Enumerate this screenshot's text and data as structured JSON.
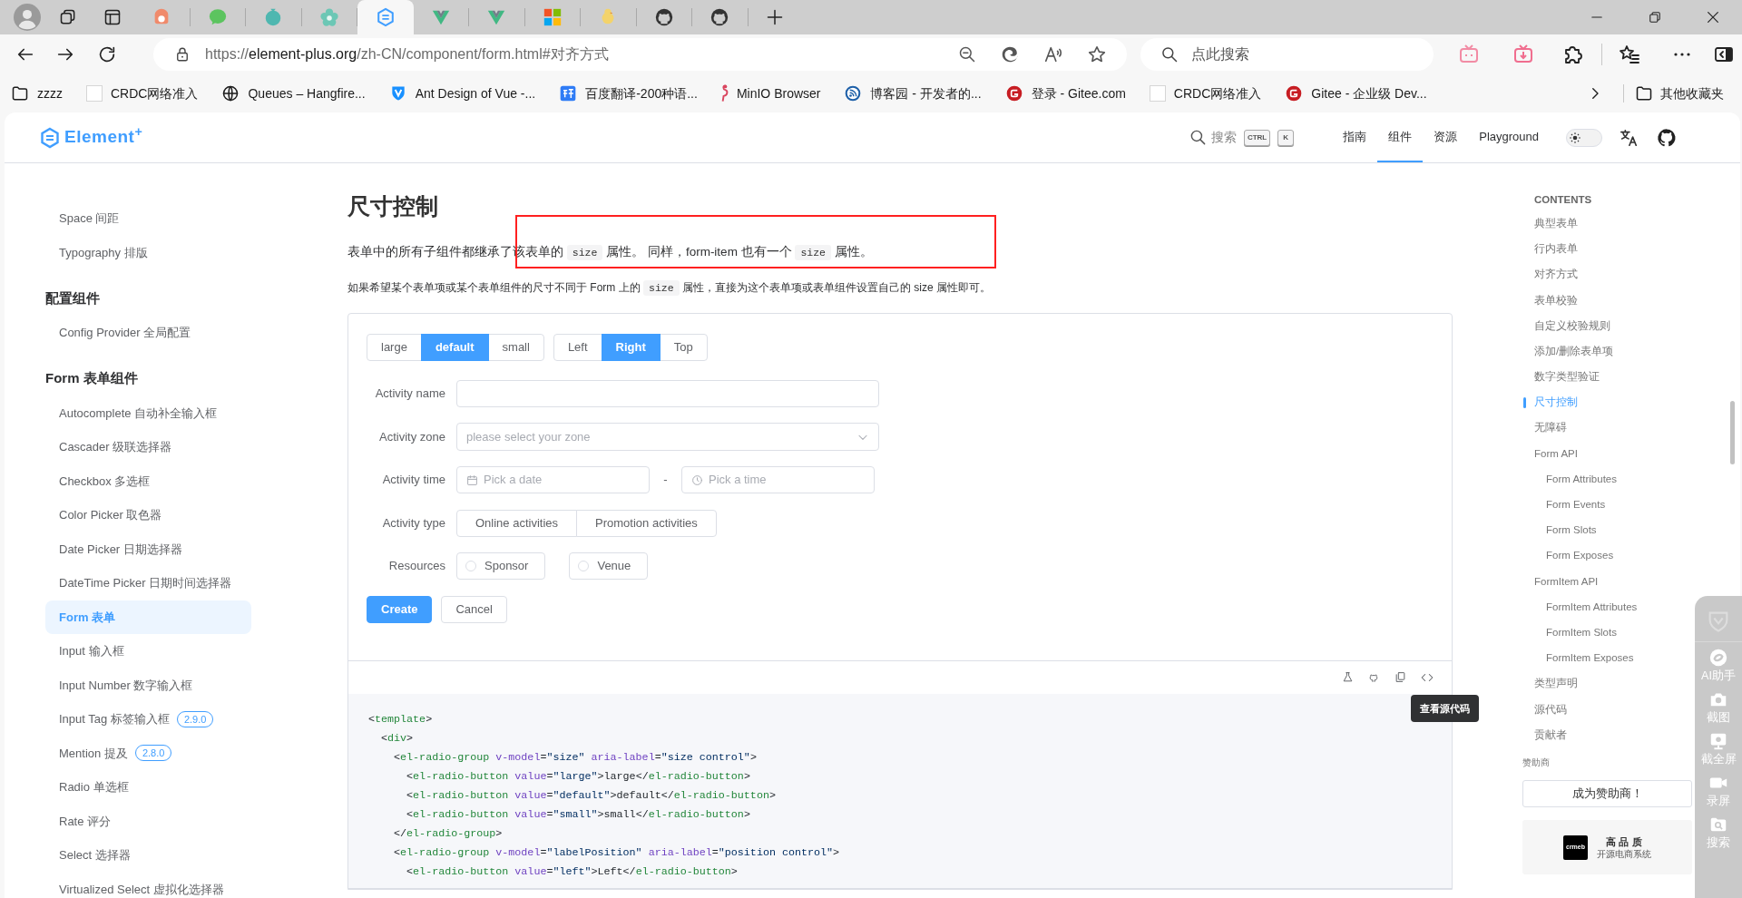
{
  "browser": {
    "tabs": [
      {
        "kind": "bowl",
        "selected": false
      },
      {
        "kind": "chat",
        "selected": false
      },
      {
        "kind": "blob",
        "selected": false
      },
      {
        "kind": "flower",
        "selected": false
      },
      {
        "kind": "hexagon",
        "selected": true
      },
      {
        "kind": "vee",
        "selected": false
      },
      {
        "kind": "vee",
        "selected": false
      },
      {
        "kind": "windows",
        "selected": false
      },
      {
        "kind": "chick",
        "selected": false
      },
      {
        "kind": "cat",
        "selected": false
      },
      {
        "kind": "cat",
        "selected": false
      }
    ],
    "address": {
      "scheme": "https://",
      "host": "element-plus.org",
      "path": "/zh-CN/component/form.html#对齐方式"
    },
    "search": {
      "placeholder": "点此搜索"
    },
    "bookmarks": [
      {
        "kind": "folder",
        "label": "zzzz"
      },
      {
        "kind": "blank",
        "label": "CRDC网络准入"
      },
      {
        "kind": "globe",
        "label": "Queues – Hangfire..."
      },
      {
        "kind": "shield",
        "label": "Ant Design of Vue -..."
      },
      {
        "kind": "translate",
        "label": "百度翻译-200种语..."
      },
      {
        "kind": "flamingo",
        "label": "MinIO Browser"
      },
      {
        "kind": "feed",
        "label": "博客园 - 开发者的..."
      },
      {
        "kind": "red",
        "label": "登录 - Gitee.com"
      },
      {
        "kind": "blank",
        "label": "CRDC网络准入"
      },
      {
        "kind": "red",
        "label": "Gitee - 企业级 Dev..."
      }
    ],
    "other_bookmarks": "其他收藏夹"
  },
  "header": {
    "logo": "Element$^{+}$",
    "search_label": "搜索",
    "keys": [
      "CTRL",
      "K"
    ],
    "nav": [
      {
        "label": "指南",
        "selected": false
      },
      {
        "label": "组件",
        "selected": true
      },
      {
        "label": "资源",
        "selected": false
      },
      {
        "label": "Playground",
        "selected": false
      }
    ],
    "dark_mode": false
  },
  "sidebar": {
    "groups": [
      {
        "items": [
          {
            "label": "Space 间距",
            "selected": false
          },
          {
            "label": "Typography 排版",
            "selected": false
          }
        ]
      },
      {
        "heading": "配置组件",
        "items": [
          {
            "label": "Config Provider 全局配置",
            "selected": false
          }
        ]
      },
      {
        "heading": "Form 表单组件",
        "items": [
          {
            "label": "Autocomplete 自动补全输入框",
            "selected": false
          },
          {
            "label": "Cascader 级联选择器",
            "selected": false
          },
          {
            "label": "Checkbox 多选框",
            "selected": false
          },
          {
            "label": "Color Picker 取色器",
            "selected": false
          },
          {
            "label": "Date Picker 日期选择器",
            "selected": false
          },
          {
            "label": "DateTime Picker 日期时间选择器",
            "selected": false
          },
          {
            "label": "Form 表单",
            "selected": true
          },
          {
            "label": "Input 输入框",
            "selected": false
          },
          {
            "label": "Input Number 数字输入框",
            "selected": false
          },
          {
            "label": "Input Tag 标签输入框",
            "selected": false,
            "badge": "2.9.0"
          },
          {
            "label": "Mention 提及",
            "selected": false,
            "badge": "2.8.0"
          },
          {
            "label": "Radio 单选框",
            "selected": false
          },
          {
            "label": "Rate 评分",
            "selected": false
          },
          {
            "label": "Select 选择器",
            "selected": false
          },
          {
            "label": "Virtualized Select 虚拟化选择器",
            "selected": false
          }
        ]
      }
    ]
  },
  "content": {
    "title": "尺寸控制",
    "paragraphs": [
      [
        {
          "text": "表单中的所有子组件都继承了该表单的 "
        },
        {
          "code": "size"
        },
        {
          "text": " 属性。 同样，form-item 也有一个 "
        },
        {
          "code": "size"
        },
        {
          "text": " 属性。"
        }
      ],
      [
        {
          "text": "如果希望某个表单项或某个表单组件的尺寸不同于 Form 上的 "
        },
        {
          "code": "size"
        },
        {
          "text": " 属性，直接为这个表单项或表单组件设置自己的 size 属性即可。"
        }
      ]
    ],
    "demo": {
      "size_group": [
        {
          "label": "large",
          "selected": false
        },
        {
          "label": "default",
          "selected": true
        },
        {
          "label": "small",
          "selected": false
        }
      ],
      "position_group": [
        {
          "label": "Left",
          "selected": false
        },
        {
          "label": "Right",
          "selected": true
        },
        {
          "label": "Top",
          "selected": false
        }
      ],
      "rows": [
        {
          "kind": "input",
          "label": "Activity name"
        },
        {
          "kind": "select",
          "label": "Activity zone",
          "placeholder": "please select your zone"
        },
        {
          "kind": "datetime",
          "label": "Activity time",
          "date_placeholder": "Pick a date",
          "separator": "-",
          "time_placeholder": "Pick a time"
        },
        {
          "kind": "checkbuttons",
          "label": "Activity type",
          "options": [
            {
              "label": "Online activities",
              "checked": false
            },
            {
              "label": "Promotion activities",
              "checked": false
            }
          ]
        },
        {
          "kind": "radios",
          "label": "Resources",
          "options": [
            {
              "label": "Sponsor",
              "selected": false
            },
            {
              "label": "Venue",
              "selected": false
            }
          ]
        }
      ],
      "actions": [
        {
          "kind": "primary",
          "label": "Create"
        },
        {
          "kind": "plain",
          "label": "Cancel"
        }
      ]
    },
    "tooltip": "查看源代码",
    "code_lines": [
      [
        {
          "kind": "punct",
          "text": "<"
        },
        {
          "kind": "tag",
          "text": "template"
        },
        {
          "kind": "punct",
          "text": ">"
        }
      ],
      [
        {
          "kind": "punct",
          "text": "  <"
        },
        {
          "kind": "tag",
          "text": "div"
        },
        {
          "kind": "punct",
          "text": ">"
        }
      ],
      [
        {
          "kind": "punct",
          "text": "    <"
        },
        {
          "kind": "tag",
          "text": "el-radio-group"
        },
        {
          "kind": "attr",
          "text": " v-model"
        },
        {
          "kind": "punct",
          "text": "="
        },
        {
          "kind": "string",
          "text": "\"size\""
        },
        {
          "kind": "attr",
          "text": " aria-label"
        },
        {
          "kind": "punct",
          "text": "="
        },
        {
          "kind": "string",
          "text": "\"size control\""
        },
        {
          "kind": "punct",
          "text": ">"
        }
      ],
      [
        {
          "kind": "punct",
          "text": "      <"
        },
        {
          "kind": "tag",
          "text": "el-radio-button"
        },
        {
          "kind": "attr",
          "text": " value"
        },
        {
          "kind": "punct",
          "text": "="
        },
        {
          "kind": "string",
          "text": "\"large\""
        },
        {
          "kind": "punct",
          "text": ">large</"
        },
        {
          "kind": "tag",
          "text": "el-radio-button"
        },
        {
          "kind": "punct",
          "text": ">"
        }
      ],
      [
        {
          "kind": "punct",
          "text": "      <"
        },
        {
          "kind": "tag",
          "text": "el-radio-button"
        },
        {
          "kind": "attr",
          "text": " value"
        },
        {
          "kind": "punct",
          "text": "="
        },
        {
          "kind": "string",
          "text": "\"default\""
        },
        {
          "kind": "punct",
          "text": ">default</"
        },
        {
          "kind": "tag",
          "text": "el-radio-button"
        },
        {
          "kind": "punct",
          "text": ">"
        }
      ],
      [
        {
          "kind": "punct",
          "text": "      <"
        },
        {
          "kind": "tag",
          "text": "el-radio-button"
        },
        {
          "kind": "attr",
          "text": " value"
        },
        {
          "kind": "punct",
          "text": "="
        },
        {
          "kind": "string",
          "text": "\"small\""
        },
        {
          "kind": "punct",
          "text": ">small</"
        },
        {
          "kind": "tag",
          "text": "el-radio-button"
        },
        {
          "kind": "punct",
          "text": ">"
        }
      ],
      [
        {
          "kind": "punct",
          "text": "    </"
        },
        {
          "kind": "tag",
          "text": "el-radio-group"
        },
        {
          "kind": "punct",
          "text": ">"
        }
      ],
      [
        {
          "kind": "punct",
          "text": "    <"
        },
        {
          "kind": "tag",
          "text": "el-radio-group"
        },
        {
          "kind": "attr",
          "text": " v-model"
        },
        {
          "kind": "punct",
          "text": "="
        },
        {
          "kind": "string",
          "text": "\"labelPosition\""
        },
        {
          "kind": "attr",
          "text": " aria-label"
        },
        {
          "kind": "punct",
          "text": "="
        },
        {
          "kind": "string",
          "text": "\"position control\""
        },
        {
          "kind": "punct",
          "text": ">"
        }
      ],
      [
        {
          "kind": "punct",
          "text": "      <"
        },
        {
          "kind": "tag",
          "text": "el-radio-button"
        },
        {
          "kind": "attr",
          "text": " value"
        },
        {
          "kind": "punct",
          "text": "="
        },
        {
          "kind": "string",
          "text": "\"left\""
        },
        {
          "kind": "punct",
          "text": ">Left</"
        },
        {
          "kind": "tag",
          "text": "el-radio-button"
        },
        {
          "kind": "punct",
          "text": ">"
        }
      ]
    ]
  },
  "toc": {
    "heading": "CONTENTS",
    "items": [
      {
        "label": "典型表单",
        "selected": false
      },
      {
        "label": "行内表单",
        "selected": false
      },
      {
        "label": "对齐方式",
        "selected": false
      },
      {
        "label": "表单校验",
        "selected": false
      },
      {
        "label": "自定义校验规则",
        "selected": false
      },
      {
        "label": "添加/删除表单项",
        "selected": false
      },
      {
        "label": "数字类型验证",
        "selected": false
      },
      {
        "label": "尺寸控制",
        "selected": true
      },
      {
        "label": "无障碍",
        "selected": false
      },
      {
        "label": "Form API",
        "selected": false,
        "children": [
          {
            "label": "Form Attributes",
            "selected": false
          },
          {
            "label": "Form Events",
            "selected": false
          },
          {
            "label": "Form Slots",
            "selected": false
          },
          {
            "label": "Form Exposes",
            "selected": false
          }
        ]
      },
      {
        "label": "FormItem API",
        "selected": false,
        "children": [
          {
            "label": "FormItem Attributes",
            "selected": false
          },
          {
            "label": "FormItem Slots",
            "selected": false
          },
          {
            "label": "FormItem Exposes",
            "selected": false
          }
        ]
      },
      {
        "label": "类型声明",
        "selected": false
      },
      {
        "label": "源代码",
        "selected": false
      },
      {
        "label": "贡献者",
        "selected": false
      }
    ],
    "sponsor_label": "赞助商",
    "sponsor_button": "成为赞助商！",
    "sponsor_card": {
      "logo": "crmeb",
      "title": "高 品 质",
      "subtitle": "开源电商系统"
    }
  },
  "side_tools": [
    {
      "kind": "shield"
    },
    {
      "kind": "ai",
      "label": "AI助手"
    },
    {
      "kind": "camera",
      "label": "截图"
    },
    {
      "kind": "monitor",
      "label": "截全屏"
    },
    {
      "kind": "video",
      "label": "录屏"
    },
    {
      "kind": "search",
      "label": "搜索"
    }
  ]
}
